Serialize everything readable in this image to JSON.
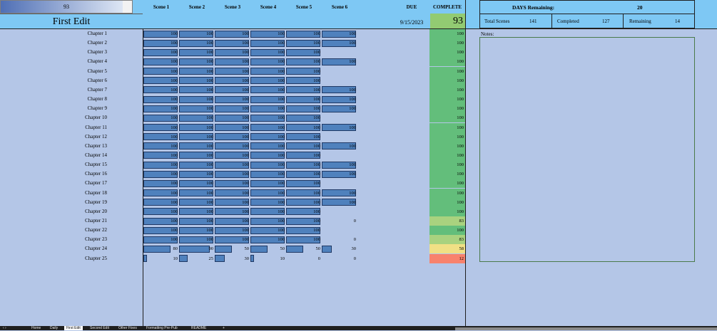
{
  "top_progress": {
    "value": "93",
    "fraction": 0.93
  },
  "header": {
    "project_title": "First Edit",
    "scene_columns": [
      "Scene 1",
      "Scene 2",
      "Scene 3",
      "Scene 4",
      "Scene 5",
      "Scene 6"
    ],
    "due_label": "DUE",
    "complete_label": "COMPLETE",
    "due_date": "9/15/2023",
    "complete_value": "93"
  },
  "stats": {
    "days_remaining_label": "DAYS Remaining:",
    "days_remaining_value": "20",
    "total_scenes_label": "Total Scenes",
    "total_scenes_value": "141",
    "completed_label": "Completed",
    "completed_value": "127",
    "remaining_label": "Remaining",
    "remaining_value": "14"
  },
  "chapters": [
    {
      "name": "Chapter 1",
      "scenes": [
        "100",
        "100",
        "100",
        "100",
        "100",
        "100"
      ],
      "complete": "100"
    },
    {
      "name": "Chapter 2",
      "scenes": [
        "100",
        "100",
        "100",
        "100",
        "100",
        "100"
      ],
      "complete": "100"
    },
    {
      "name": "Chapter 3",
      "scenes": [
        "100",
        "100",
        "100",
        "100",
        "100",
        ""
      ],
      "complete": "100"
    },
    {
      "name": "Chapter 4",
      "scenes": [
        "100",
        "100",
        "100",
        "100",
        "100",
        "100"
      ],
      "complete": "100"
    },
    {
      "name": "Chapter 5",
      "scenes": [
        "100",
        "100",
        "100",
        "100",
        "100",
        ""
      ],
      "complete": "100"
    },
    {
      "name": "Chapter 6",
      "scenes": [
        "100",
        "100",
        "100",
        "100",
        "100",
        ""
      ],
      "complete": "100"
    },
    {
      "name": "Chapter 7",
      "scenes": [
        "100",
        "100",
        "100",
        "100",
        "100",
        "100"
      ],
      "complete": "100"
    },
    {
      "name": "Chapter 8",
      "scenes": [
        "100",
        "100",
        "100",
        "100",
        "100",
        "100"
      ],
      "complete": "100"
    },
    {
      "name": "Chapter 9",
      "scenes": [
        "100",
        "100",
        "100",
        "100",
        "100",
        "100"
      ],
      "complete": "100"
    },
    {
      "name": "Chapter 10",
      "scenes": [
        "100",
        "100",
        "100",
        "100",
        "100",
        ""
      ],
      "complete": "100"
    },
    {
      "name": "Chapter 11",
      "scenes": [
        "100",
        "100",
        "100",
        "100",
        "100",
        "100"
      ],
      "complete": "100"
    },
    {
      "name": "Chapter 12",
      "scenes": [
        "100",
        "100",
        "100",
        "100",
        "100",
        ""
      ],
      "complete": "100"
    },
    {
      "name": "Chapter 13",
      "scenes": [
        "100",
        "100",
        "100",
        "100",
        "100",
        "100"
      ],
      "complete": "100"
    },
    {
      "name": "Chapter 14",
      "scenes": [
        "100",
        "100",
        "100",
        "100",
        "100",
        ""
      ],
      "complete": "100"
    },
    {
      "name": "Chapter 15",
      "scenes": [
        "100",
        "100",
        "100",
        "100",
        "100",
        "100"
      ],
      "complete": "100"
    },
    {
      "name": "Chapter 16",
      "scenes": [
        "100",
        "100",
        "100",
        "100",
        "100",
        "100"
      ],
      "complete": "100"
    },
    {
      "name": "Chapter 17",
      "scenes": [
        "100",
        "100",
        "100",
        "100",
        "100",
        ""
      ],
      "complete": "100"
    },
    {
      "name": "Chapter 18",
      "scenes": [
        "100",
        "100",
        "100",
        "100",
        "100",
        "100"
      ],
      "complete": "100"
    },
    {
      "name": "Chapter 19",
      "scenes": [
        "100",
        "100",
        "100",
        "100",
        "100",
        "100"
      ],
      "complete": "100"
    },
    {
      "name": "Chapter 20",
      "scenes": [
        "100",
        "100",
        "100",
        "100",
        "100",
        ""
      ],
      "complete": "100"
    },
    {
      "name": "Chapter 21",
      "scenes": [
        "100",
        "100",
        "100",
        "100",
        "100",
        "0"
      ],
      "complete": "83"
    },
    {
      "name": "Chapter 22",
      "scenes": [
        "100",
        "100",
        "100",
        "100",
        "100",
        ""
      ],
      "complete": "100"
    },
    {
      "name": "Chapter 23",
      "scenes": [
        "100",
        "100",
        "100",
        "100",
        "100",
        "0"
      ],
      "complete": "83"
    },
    {
      "name": "Chapter 24",
      "scenes": [
        "80",
        "90",
        "50",
        "50",
        "50",
        "30"
      ],
      "complete": "58"
    },
    {
      "name": "Chapter 25",
      "scenes": [
        "10",
        "25",
        "30",
        "10",
        "0",
        "0"
      ],
      "complete": "12"
    }
  ],
  "complete_colors": {
    "100": "#63be7b",
    "83": "#a9d27f",
    "58": "#f0e085",
    "12": "#f8826d"
  },
  "bar_color": "#4f81bd",
  "notes": {
    "label": "Notes:"
  },
  "sheet_tabs": [
    "Home",
    "Daily",
    "First Edit",
    "Second Edit",
    "Other Fixes",
    "Formatting Pre-Pub",
    "README",
    "+"
  ]
}
